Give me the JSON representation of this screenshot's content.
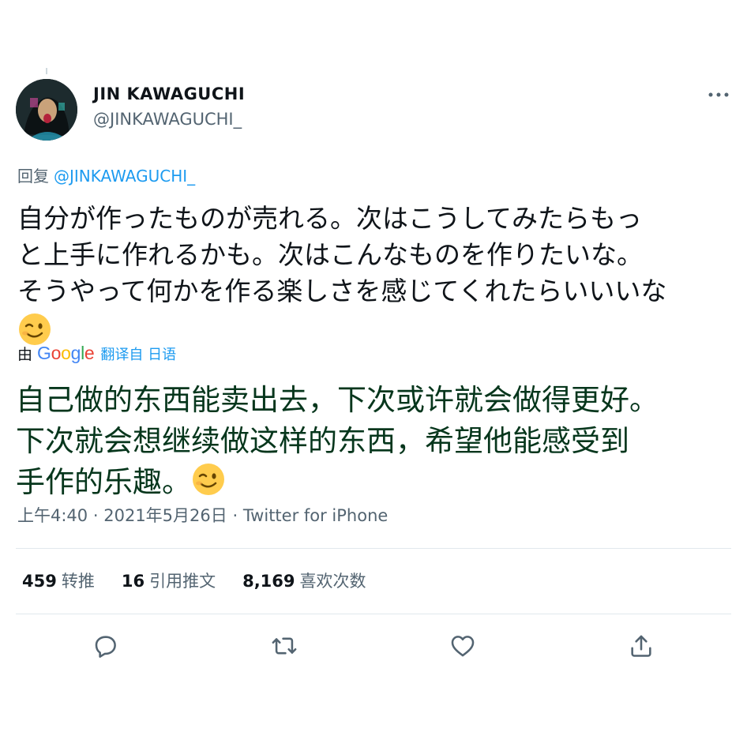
{
  "user": {
    "display_name": "JIN KAWAGUCHI",
    "handle": "@JINKAWAGUCHI_"
  },
  "reply": {
    "prefix": "回复",
    "mention": "@JINKAWAGUCHI_"
  },
  "tweet": {
    "lines": [
      "自分が作ったものが売れる。次はこうしてみたらもっ",
      "と上手に作れるかも。次はこんなものを作りたいな。",
      "そうやって何かを作る楽しさを感じてくれたらいいいな"
    ],
    "emoji": "winking-face"
  },
  "translation": {
    "by_label": "由",
    "provider": "Google",
    "from_label": "翻译自 日语",
    "lines": [
      "自己做的东西能卖出去，下次或许就会做得更好。",
      "下次就会想继续做这样的东西，希望他能感受到",
      "手作的乐趣。"
    ],
    "emoji": "winking-face"
  },
  "meta": {
    "time": "上午4:40",
    "date": "2021年5月26日",
    "source": "Twitter for iPhone",
    "separator": "·"
  },
  "stats": {
    "retweets": {
      "count": "459",
      "label": "转推"
    },
    "quotes": {
      "count": "16",
      "label": "引用推文"
    },
    "likes": {
      "count": "8,169",
      "label": "喜欢次数"
    }
  },
  "actions": {
    "icons": [
      "reply-icon",
      "retweet-icon",
      "like-icon",
      "share-icon"
    ]
  },
  "colors": {
    "link": "#1d9bf0",
    "secondary_text": "#536471",
    "primary_text": "#0f1419",
    "translation_text": "#06361c",
    "divider": "#e1e8ed"
  }
}
